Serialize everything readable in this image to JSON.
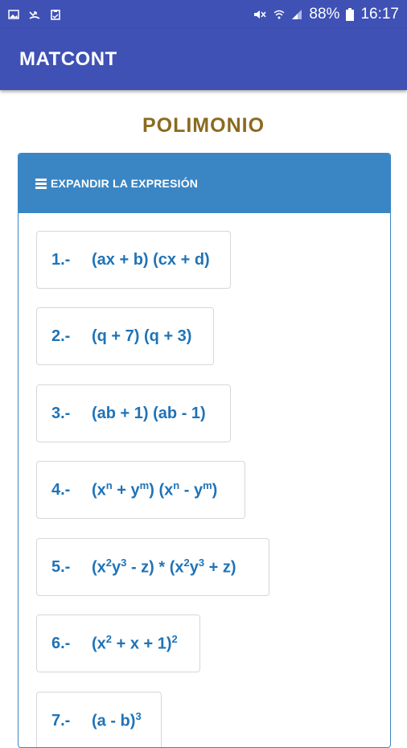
{
  "status_bar": {
    "battery": "88%",
    "time": "16:17"
  },
  "app_bar": {
    "title": "MATCONT"
  },
  "page": {
    "heading": "POLIMONIO"
  },
  "panel": {
    "header_label": "EXPANDIR LA EXPRESIÓN",
    "items": [
      {
        "number": "1.-",
        "expression": "(ax + b) (cx + d)"
      },
      {
        "number": "2.-",
        "expression": "(q + 7) (q + 3)"
      },
      {
        "number": "3.-",
        "expression": "(ab + 1) (ab - 1)"
      },
      {
        "number": "4.-",
        "expression": "(x^n + y^m) (x^n - y^m)"
      },
      {
        "number": "5.-",
        "expression": "(x^2y^3 - z) * (x^2y^3 + z)"
      },
      {
        "number": "6.-",
        "expression": "(x^2 + x + 1)^2"
      },
      {
        "number": "7.-",
        "expression": "(a - b)^3"
      }
    ]
  },
  "colors": {
    "app_bar": "#3f51b5",
    "panel_header": "#3a86c4",
    "heading": "#8b6a1e",
    "item_text": "#1f73b7"
  }
}
